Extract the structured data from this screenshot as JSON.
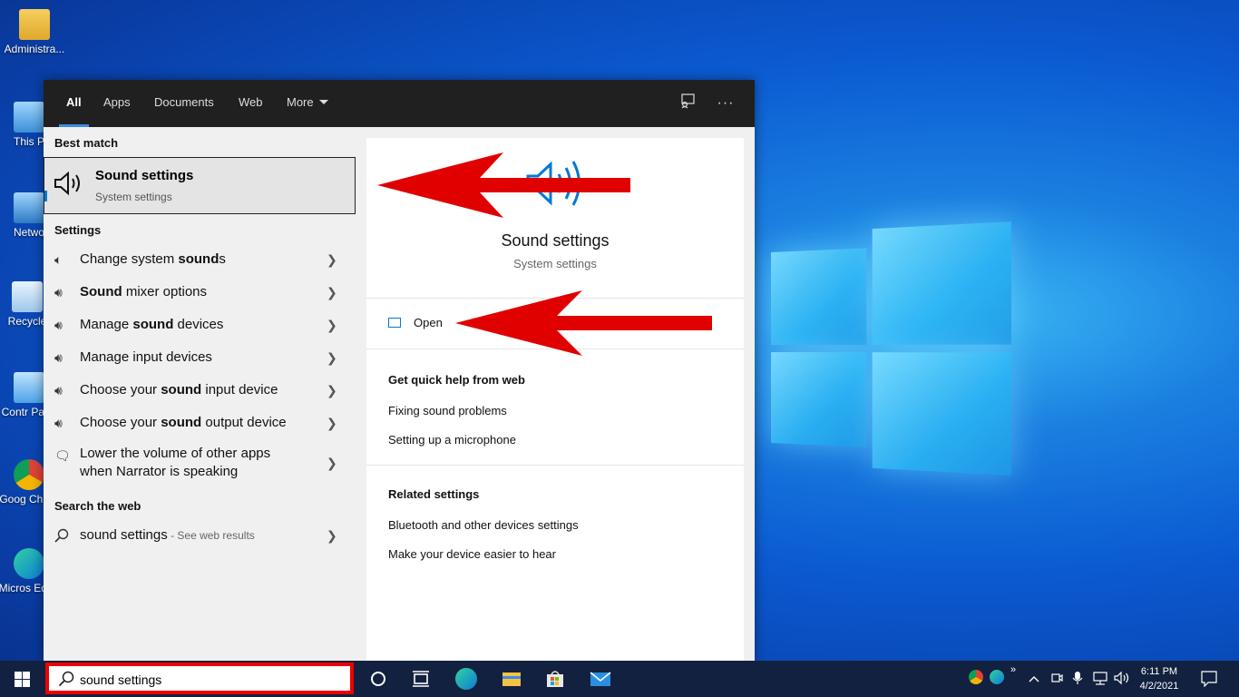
{
  "desktop": {
    "icons": [
      {
        "label": "Administra..."
      },
      {
        "label": "This P"
      },
      {
        "label": "Netwo"
      },
      {
        "label": "Recycle"
      },
      {
        "label": "Contr Pane"
      },
      {
        "label": "Goog Chron"
      },
      {
        "label": "Micros Edge"
      }
    ]
  },
  "search_panel": {
    "tabs": [
      {
        "label": "All",
        "active": true
      },
      {
        "label": "Apps"
      },
      {
        "label": "Documents"
      },
      {
        "label": "Web"
      },
      {
        "label": "More"
      }
    ],
    "best_match_heading": "Best match",
    "best_match": {
      "title": "Sound settings",
      "subtitle": "System settings"
    },
    "settings_heading": "Settings",
    "settings_items": [
      {
        "pre": "Change system ",
        "bold": "sound",
        "post": "s"
      },
      {
        "pre": "",
        "bold": "Sound",
        "post": " mixer options"
      },
      {
        "pre": "Manage ",
        "bold": "sound",
        "post": " devices"
      },
      {
        "pre": "Manage input devices",
        "bold": "",
        "post": ""
      },
      {
        "pre": "Choose your ",
        "bold": "sound",
        "post": " input device"
      },
      {
        "pre": "Choose your ",
        "bold": "sound",
        "post": " output device"
      },
      {
        "pre": "Lower the volume of other apps when Narrator is speaking",
        "bold": "",
        "post": ""
      }
    ],
    "web_heading": "Search the web",
    "web_item": {
      "query": "sound settings",
      "suffix": " - See web results"
    },
    "preview": {
      "title": "Sound settings",
      "subtitle": "System settings",
      "open_label": "Open",
      "quick_help_heading": "Get quick help from web",
      "quick_help_links": [
        "Fixing sound problems",
        "Setting up a microphone"
      ],
      "related_heading": "Related settings",
      "related_links": [
        "Bluetooth and other devices settings",
        "Make your device easier to hear"
      ]
    }
  },
  "taskbar": {
    "search_value": "sound settings",
    "clock_time": "6:11 PM",
    "clock_date": "4/2/2021"
  },
  "colors": {
    "accent": "#0078d7",
    "annotation_red": "#e00000",
    "taskbar": "#12213f"
  }
}
